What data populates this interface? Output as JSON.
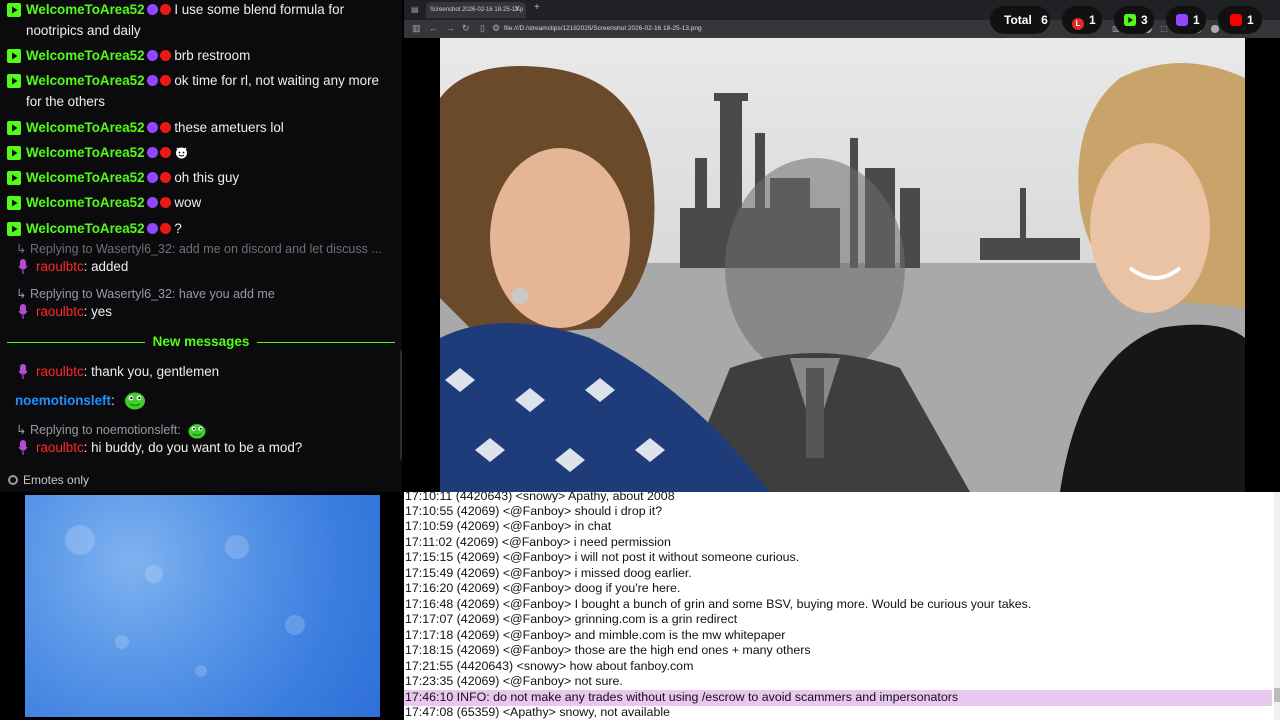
{
  "chat": {
    "kick_messages": [
      {
        "user": "WelcomeToArea52",
        "text": "I use some blend formula for",
        "cont": "nootripics and daily"
      },
      {
        "user": "WelcomeToArea52",
        "text": "brb restroom"
      },
      {
        "user": "WelcomeToArea52",
        "text": "ok time for rl, not waiting any more",
        "cont": "for the others"
      },
      {
        "user": "WelcomeToArea52",
        "text": "these ametuers lol"
      },
      {
        "user": "WelcomeToArea52",
        "text": "",
        "emoji": "smiling-devil-emoji"
      },
      {
        "user": "WelcomeToArea52",
        "text": "oh this guy"
      },
      {
        "user": "WelcomeToArea52",
        "text": "wow"
      },
      {
        "user": "WelcomeToArea52",
        "text": "?"
      }
    ],
    "reply1": "Replying to Wasertyl6_32: add me on discord and let discuss ...",
    "msg_raoul1": {
      "user": "raoulbtc",
      "text": ": added"
    },
    "reply2": "Replying to Wasertyl6_32: have you add me",
    "msg_raoul2": {
      "user": "raoulbtc",
      "text": ": yes"
    },
    "new_messages_label": "New messages",
    "msg_raoul3": {
      "user": "raoulbtc",
      "text": ": thank you, gentlemen"
    },
    "msg_noemotions": {
      "user": "noemotionsleft",
      "text": ":"
    },
    "reply3": "Replying to noemotionsleft:",
    "msg_raoul4": {
      "user": "raoulbtc",
      "text": ": hi buddy, do you want to be a mod?"
    },
    "emotes_only": "Emotes only"
  },
  "browser": {
    "tab_title": "Screenshot 2026-02-16 18-25-13.p",
    "url": "file:///D:/streamclips/12182025/Screenshot 2026-02-16 18-25-13.png"
  },
  "counters": {
    "total_label": "Total",
    "total": "6",
    "platforms": [
      {
        "name": "L",
        "count": "1",
        "color": "#e32a2a"
      },
      {
        "name": "kick",
        "count": "3",
        "color": "#53fc18"
      },
      {
        "name": "twitch",
        "count": "1",
        "color": "#9146ff"
      },
      {
        "name": "youtube",
        "count": "1",
        "color": "#ff0000"
      }
    ]
  },
  "irc": [
    "17:10:11 (4420643) <snowy> Apathy, about 2008",
    "17:10:55 (42069) <@Fanboy> should i drop it?",
    "17:10:59 (42069) <@Fanboy> in chat",
    "17:11:02 (42069) <@Fanboy> i need permission",
    "17:15:15 (42069) <@Fanboy> i will not post it without someone curious.",
    "17:15:49 (42069) <@Fanboy> i missed doog earlier.",
    "17:16:20 (42069) <@Fanboy> doog if you're here.",
    "17:16:48 (42069) <@Fanboy> I bought a bunch of grin and some BSV, buying more. Would be curious your takes.",
    "17:17:07 (42069) <@Fanboy> grinning.com is a grin redirect",
    "17:17:18 (42069) <@Fanboy> and mimble.com is the mw whitepaper",
    "17:18:15 (42069) <@Fanboy> those are the high end ones + many others",
    "17:21:55 (4420643) <snowy> how about fanboy.com",
    "17:23:35 (42069) <@Fanboy> not sure.",
    "17:46:10 INFO: do not make any trades without using /escrow to avoid scammers and impersonators",
    "17:47:08 (65359) <Apathy> snowy, not available"
  ],
  "irc_highlight_color": "#e9c8f0",
  "accent_kick": "#53fc18",
  "accent_twitch_user": "#ff2a2a"
}
